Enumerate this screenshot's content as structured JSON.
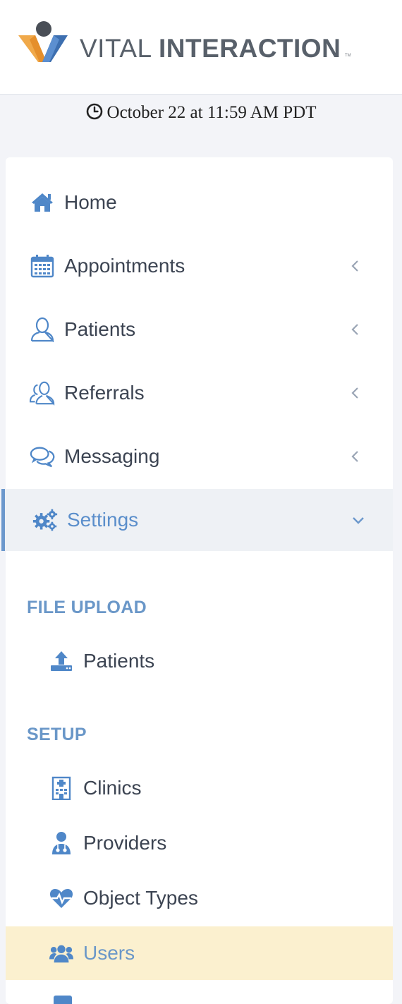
{
  "brand": {
    "name_light": "VITAL",
    "name_bold": "INTERACTION",
    "trademark": "TM"
  },
  "timestamp": "October 22 at 11:59 AM PDT",
  "colors": {
    "accent": "#6a97c8",
    "icon_blue": "#4f87c8",
    "selected_bg": "#fbf0cf",
    "active_bg": "#eef1f5"
  },
  "nav": {
    "items": [
      {
        "label": "Home",
        "icon": "home-icon"
      },
      {
        "label": "Appointments",
        "icon": "calendar-icon"
      },
      {
        "label": "Patients",
        "icon": "user-icon"
      },
      {
        "label": "Referrals",
        "icon": "users-icon"
      },
      {
        "label": "Messaging",
        "icon": "chat-icon"
      },
      {
        "label": "Settings",
        "icon": "gears-icon"
      }
    ]
  },
  "settings": {
    "file_upload": {
      "header": "FILE UPLOAD",
      "items": [
        {
          "label": "Patients",
          "icon": "upload-icon"
        }
      ]
    },
    "setup": {
      "header": "SETUP",
      "items": [
        {
          "label": "Clinics",
          "icon": "hospital-icon"
        },
        {
          "label": "Providers",
          "icon": "doctor-icon"
        },
        {
          "label": "Object Types",
          "icon": "heartbeat-icon"
        },
        {
          "label": "Users",
          "icon": "group-icon"
        }
      ]
    }
  }
}
